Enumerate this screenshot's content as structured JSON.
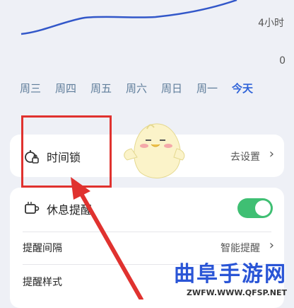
{
  "chart": {
    "y_top_label": "4小时",
    "y_bottom_label": "0"
  },
  "days": [
    "周三",
    "周四",
    "周五",
    "周六",
    "周日",
    "周一",
    "今天"
  ],
  "time_lock": {
    "label": "时间锁",
    "action": "去设置"
  },
  "rest_reminder": {
    "label": "休息提醒",
    "enabled": true,
    "interval_label": "提醒间隔",
    "interval_value": "智能提醒",
    "style_label": "提醒样式"
  },
  "watermark": {
    "text": "曲阜手游网",
    "url": "ZWFW.WWW.QFSP.NET"
  },
  "colors": {
    "accent": "#2f63d8",
    "toggle_on": "#3fbf73",
    "highlight": "#e0322f"
  }
}
